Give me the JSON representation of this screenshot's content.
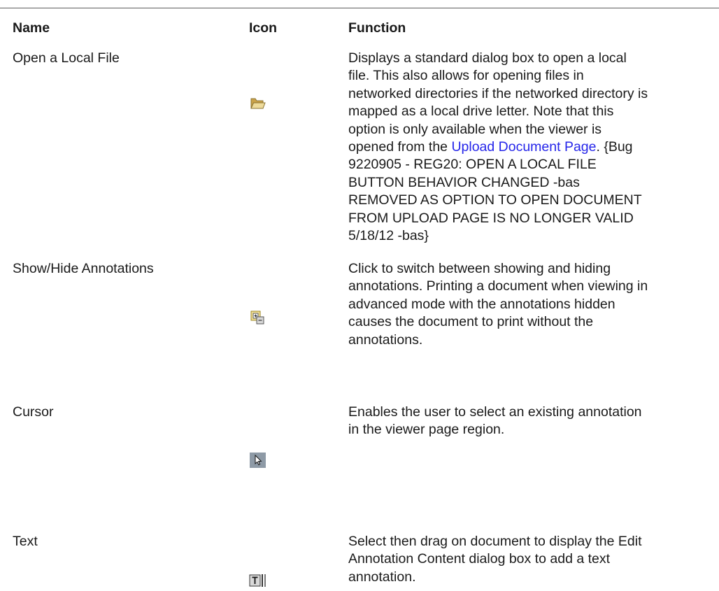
{
  "table": {
    "headers": {
      "name": "Name",
      "icon": "Icon",
      "function": "Function"
    },
    "rows": [
      {
        "name": "Open a Local File",
        "icon": "open-folder-icon",
        "function_lines": [
          "Displays a standard dialog box to open a local",
          "file. This also allows for opening files in",
          "networked directories if the networked directory is",
          "mapped as a local drive letter. Note that this",
          "option is only available when the viewer is"
        ],
        "function_link_prefix": "opened from the ",
        "function_link_text": "Upload Document Page",
        "function_link_suffix": ". {Bug",
        "function_lines_after": [
          "9220905 - REG20: OPEN A LOCAL FILE",
          "BUTTON BEHAVIOR CHANGED -bas",
          "REMOVED AS OPTION TO OPEN DOCUMENT",
          "FROM UPLOAD PAGE IS NO LONGER VALID",
          "5/18/12 -bas}"
        ]
      },
      {
        "name": "Show/Hide Annotations",
        "icon": "show-hide-annotations-icon",
        "function_lines": [
          "Click to switch between showing and hiding",
          "annotations. Printing a document when viewing in",
          "advanced mode with the annotations hidden",
          "causes the document to print without the",
          "annotations."
        ]
      },
      {
        "name": "Cursor",
        "icon": "cursor-arrow-icon",
        "function_lines": [
          "Enables the user to select an existing annotation",
          "in the viewer page region."
        ]
      },
      {
        "name": "Text",
        "icon": "text-annotation-icon",
        "function_lines": [
          "Select then drag on document to display the Edit",
          "Annotation Content dialog box to add a text",
          "annotation."
        ]
      }
    ]
  },
  "colors": {
    "link": "#2525ea",
    "text": "#1a1a1a",
    "rule": "#5a5a5a"
  }
}
